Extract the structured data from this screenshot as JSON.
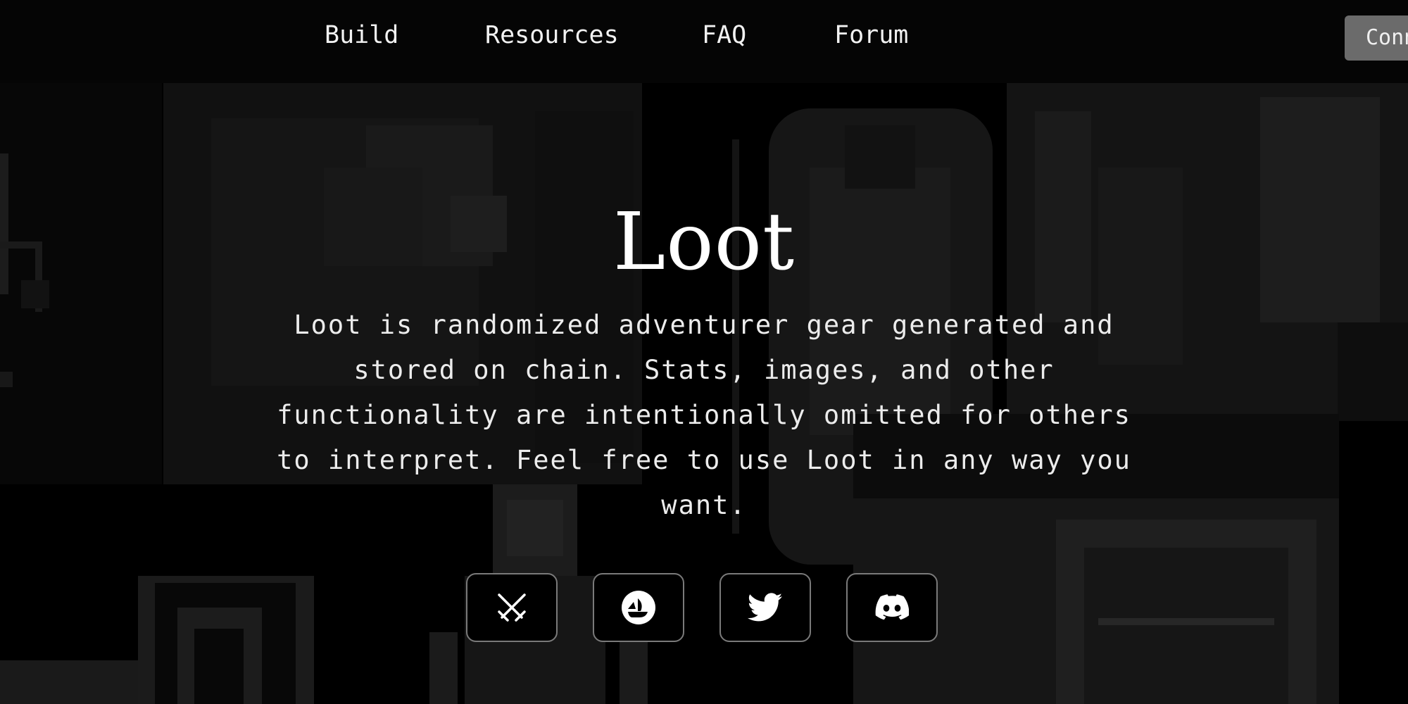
{
  "nav": {
    "links": [
      "Build",
      "Resources",
      "FAQ",
      "Forum"
    ],
    "connect_label": "Connect"
  },
  "hero": {
    "title": "Loot",
    "description": "Loot is randomized adventurer gear generated and stored on chain. Stats, images, and other functionality are intentionally omitted for others to interpret. Feel free to use Loot in any way you want."
  },
  "socials": [
    {
      "icon": "crossed-swords-icon",
      "label": "Loot"
    },
    {
      "icon": "opensea-icon",
      "label": "OpenSea"
    },
    {
      "icon": "twitter-icon",
      "label": "Twitter"
    },
    {
      "icon": "discord-icon",
      "label": "Discord"
    }
  ],
  "colors": {
    "background": "#000000",
    "navbar": "#050505",
    "connect_button": "#6b6b6b",
    "text": "#ffffff",
    "button_border": "#7a7a7a"
  }
}
